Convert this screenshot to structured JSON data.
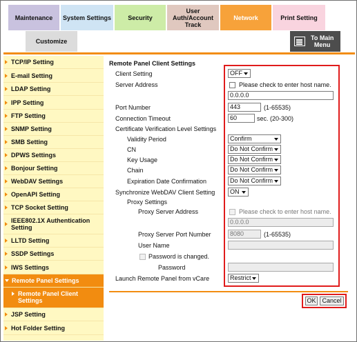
{
  "tabs": {
    "maintenance": "Maintenance",
    "system_settings": "System Settings",
    "security": "Security",
    "user_auth_line1": "User",
    "user_auth_line2": "Auth/Account",
    "user_auth_line3": "Track",
    "network": "Network",
    "print_settings": "Print Setting",
    "customize": "Customize",
    "main_menu_line1": "To Main",
    "main_menu_line2": "Menu"
  },
  "sidebar": {
    "items": [
      "TCP/IP Setting",
      "E-mail Setting",
      "LDAP Setting",
      "IPP Setting",
      "FTP Setting",
      "SNMP Setting",
      "SMB Setting",
      "DPWS Settings",
      "Bonjour Setting",
      "WebDAV Settings",
      "OpenAPI Setting",
      "TCP Socket Setting",
      "IEEE802.1X Authentication Setting",
      "LLTD Setting",
      "SSDP Settings",
      "IWS Settings",
      "Remote Panel Settings",
      "Remote Panel Client Settings",
      "JSP Setting",
      "Hot Folder Setting"
    ]
  },
  "main": {
    "title": "Remote Panel Client Settings",
    "client_setting_label": "Client Setting",
    "client_setting_value": "OFF",
    "server_address_label": "Server Address",
    "host_name_check": "Please check to enter host name.",
    "server_address_value": "0.0.0.0",
    "port_label": "Port Number",
    "port_value": "443",
    "port_range": "(1-65535)",
    "timeout_label": "Connection Timeout",
    "timeout_value": "60",
    "timeout_unit": "sec. (20-300)",
    "cert_label": "Certificate Verification Level Settings",
    "validity_label": "Validity Period",
    "validity_value": "Confirm",
    "cn_label": "CN",
    "cn_value": "Do Not Confirm",
    "key_usage_label": "Key Usage",
    "key_usage_value": "Do Not Confirm",
    "chain_label": "Chain",
    "chain_value": "Do Not Confirm",
    "expiration_label": "Expiration Date Confirmation",
    "expiration_value": "Do Not Confirm",
    "sync_label": "Synchronize WebDAV Client Setting",
    "sync_value": "ON",
    "proxy_label": "Proxy Settings",
    "proxy_address_label": "Proxy Server Address",
    "proxy_host_check": "Please check to enter host name.",
    "proxy_address_value": "0.0.0.0",
    "proxy_port_label": "Proxy Server Port Number",
    "proxy_port_value": "8080",
    "proxy_port_range": "(1-65535)",
    "user_name_label": "User Name",
    "user_name_value": "",
    "password_changed_label": "Password is changed.",
    "password_label": "Password",
    "password_value": "",
    "launch_label": "Launch Remote Panel from vCare",
    "launch_value": "Restrict",
    "ok_label": "OK",
    "cancel_label": "Cancel"
  },
  "colors": {
    "accent": "#f28c10",
    "highlight_border": "#e01b1b",
    "sidebar_bg": "#fff8c2"
  }
}
